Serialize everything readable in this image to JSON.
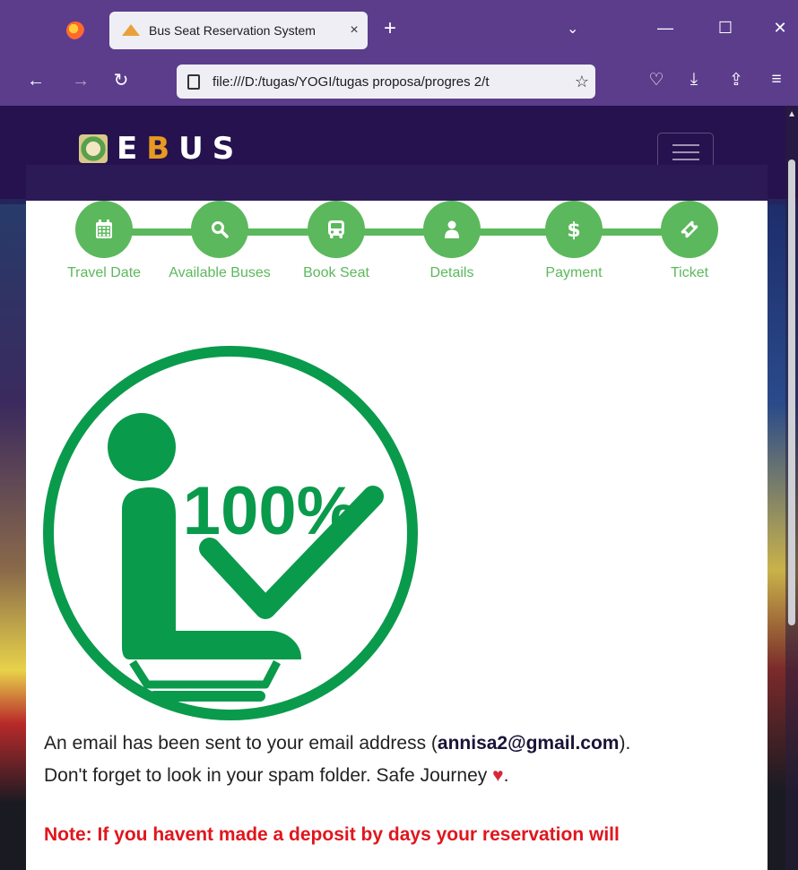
{
  "browser": {
    "tab_title": "Bus Seat Reservation System",
    "tab_close": "×",
    "new_tab": "+",
    "list_tabs": "⌄",
    "minimize": "—",
    "maximize": "☐",
    "close": "✕",
    "back": "←",
    "forward": "→",
    "reload": "↻",
    "url": "file:///D:/tugas/YOGI/tugas proposa/progres 2/t",
    "bookmark": "☆",
    "pocket": "♡",
    "downloads": "⤓",
    "share": "⇪",
    "menu": "≡"
  },
  "site": {
    "logo_e": "E",
    "logo_b": "B",
    "logo_us": "US"
  },
  "stepper": {
    "steps": [
      {
        "label": "Travel Date",
        "icon": "calendar-icon"
      },
      {
        "label": "Available Buses",
        "icon": "search-icon"
      },
      {
        "label": "Book Seat",
        "icon": "bus-icon"
      },
      {
        "label": "Details",
        "icon": "user-icon"
      },
      {
        "label": "Payment",
        "icon": "dollar-icon"
      },
      {
        "label": "Ticket",
        "icon": "ticket-icon"
      }
    ]
  },
  "graphic": {
    "percent_text": "100%"
  },
  "confirmation": {
    "line1_prefix": "An email has been sent to your email address (",
    "email": "annisa2@gmail.com",
    "line1_suffix": ").",
    "line2": "Don't forget to look in your spam folder. Safe Journey",
    "heart": "♥",
    "line2_end": ".",
    "note": "Note: If you havent made a deposit by days your reservation will"
  },
  "colors": {
    "accent_green": "#5cb85c",
    "graphic_green": "#0a9a4c",
    "note_red": "#e0161d",
    "browser_purple": "#5b3d8c"
  }
}
